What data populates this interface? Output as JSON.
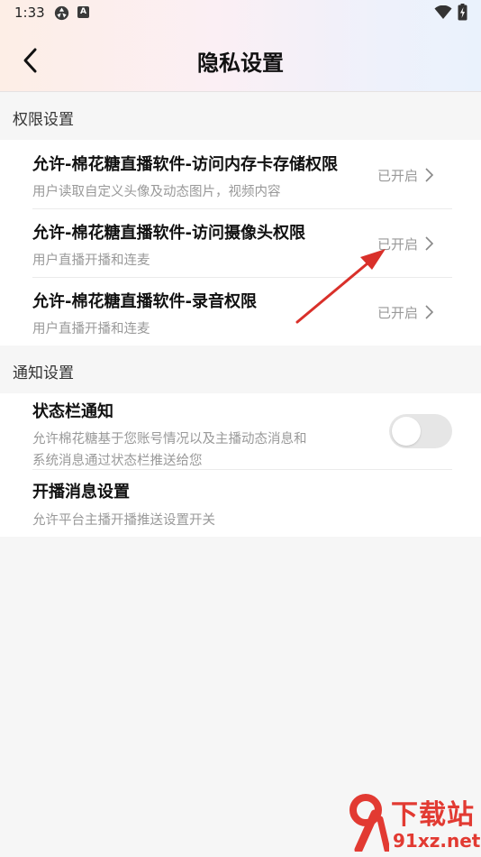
{
  "status_bar": {
    "time": "1:33",
    "notif_icon_letter": "A"
  },
  "header": {
    "title": "隐私设置"
  },
  "permissions": {
    "section_title": "权限设置",
    "items": [
      {
        "title": "允许-棉花糖直播软件-访问内存卡存储权限",
        "description": "用户读取自定义头像及动态图片，视频内容",
        "status": "已开启"
      },
      {
        "title": "允许-棉花糖直播软件-访问摄像头权限",
        "description": "用户直播开播和连麦",
        "status": "已开启"
      },
      {
        "title": "允许-棉花糖直播软件-录音权限",
        "description": "用户直播开播和连麦",
        "status": "已开启"
      }
    ]
  },
  "notifications": {
    "section_title": "通知设置",
    "items": [
      {
        "title": "状态栏通知",
        "description_line1": "允许棉花糖基于您账号情况以及主播动态消息和",
        "description_line2": "系统消息通过状态栏推送给您",
        "toggle_on": false
      },
      {
        "title": "开播消息设置",
        "description": "允许平台主播开播推送设置开关"
      }
    ]
  },
  "watermark": {
    "title": "下载站",
    "url": "91xz.net"
  },
  "colors": {
    "annotation_arrow": "#d9302a",
    "watermark": "#e23a32",
    "status_text": "#999999"
  },
  "icons": [
    "back-arrow-icon",
    "chevron-right-icon",
    "wifi-icon",
    "battery-icon",
    "status-app-icon"
  ]
}
